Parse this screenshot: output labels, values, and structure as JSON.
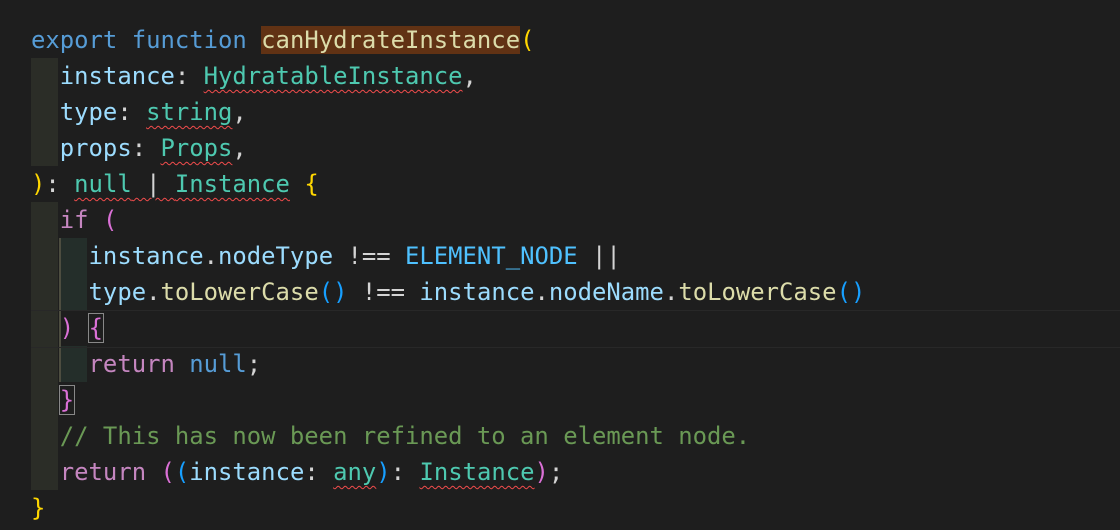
{
  "code": {
    "l1": {
      "export": "export",
      "function": "function",
      "name": "canHydrateInstance",
      "paren": "("
    },
    "l2": {
      "param": "instance",
      "colon": ": ",
      "type": "HydratableInstance",
      "comma": ","
    },
    "l3": {
      "param": "type",
      "colon": ": ",
      "type": "string",
      "comma": ","
    },
    "l4": {
      "param": "props",
      "colon": ": ",
      "type": "Props",
      "comma": ","
    },
    "l5": {
      "close": ")",
      "colon": ": ",
      "null": "null",
      "pipe": " | ",
      "type": "Instance",
      "brace": "{"
    },
    "l6": {
      "if": "if",
      "paren": "("
    },
    "l7": {
      "obj": "instance",
      "dot": ".",
      "prop": "nodeType",
      "op": " !== ",
      "const": "ELEMENT_NODE",
      "or": " ||"
    },
    "l8": {
      "obj": "type",
      "dot": ".",
      "method": "toLowerCase",
      "call": "()",
      "op": " !== ",
      "obj2": "instance",
      "dot2": ".",
      "prop": "nodeName",
      "dot3": ".",
      "method2": "toLowerCase",
      "call2": "()"
    },
    "l9": {
      "close": ")",
      "brace": "{"
    },
    "l10": {
      "return": "return",
      "null": "null",
      "semi": ";"
    },
    "l11": {
      "brace": "}"
    },
    "l12": {
      "comment": "// This has now been refined to an element node."
    },
    "l13": {
      "return": "return",
      "p1": "(",
      "p2": "(",
      "obj": "instance",
      "colon": ": ",
      "any": "any",
      "p3": ")",
      "colon2": ": ",
      "type": "Instance",
      "p4": ")",
      "semi": ";"
    },
    "l14": {
      "brace": "}"
    }
  },
  "colors": {
    "background": "#1e1e1e",
    "keyword": "#569cd6",
    "control": "#c586c0",
    "function": "#dcdcaa",
    "variable": "#9cdcfe",
    "type": "#4ec9b0",
    "constant": "#4fc1ff",
    "comment": "#6a9955",
    "bracket_level1": "#ffd700",
    "bracket_level2": "#da70d6",
    "bracket_level3": "#179fff",
    "error_squiggle": "#f14c4c",
    "selection_highlight": "#613214"
  }
}
